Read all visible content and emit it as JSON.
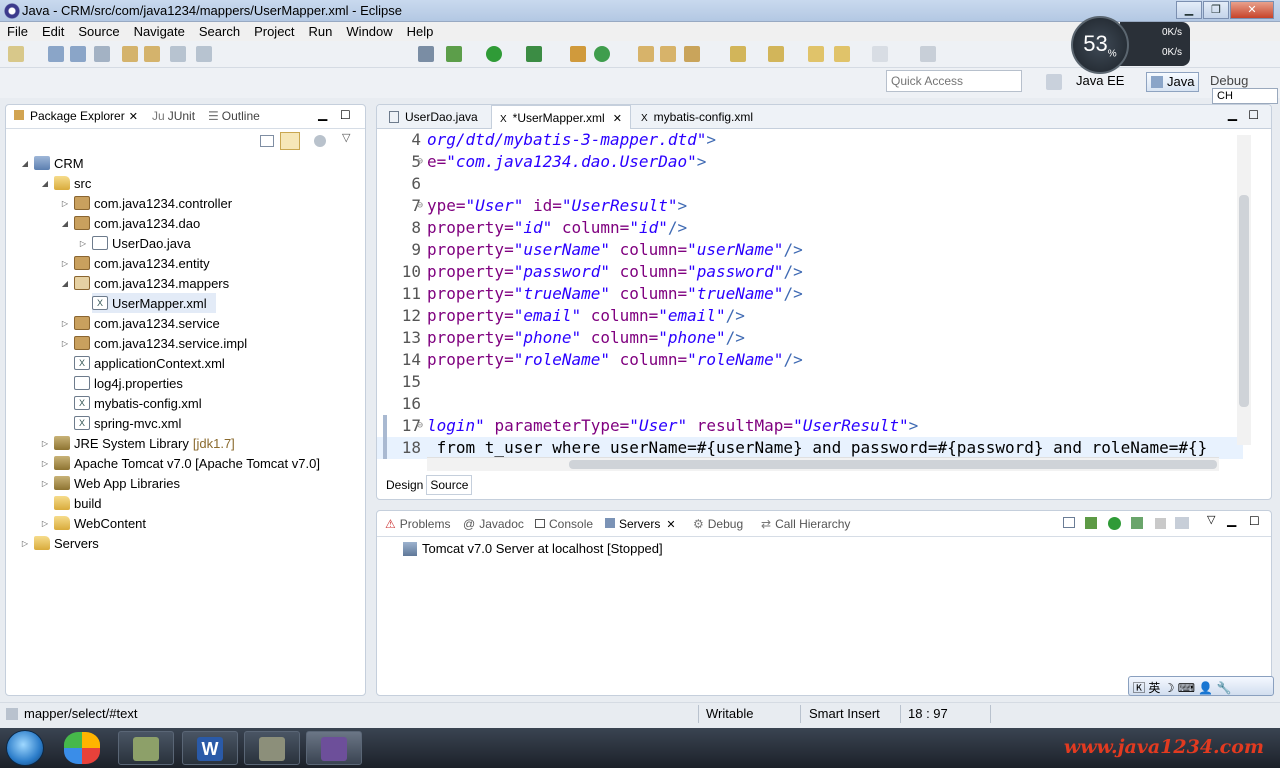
{
  "window": {
    "title": "Java - CRM/src/com/java1234/mappers/UserMapper.xml - Eclipse"
  },
  "menu": [
    "File",
    "Edit",
    "Source",
    "Navigate",
    "Search",
    "Project",
    "Run",
    "Window",
    "Help"
  ],
  "quick_access": {
    "placeholder": "Quick Access"
  },
  "perspectives": {
    "java_ee": "Java EE",
    "java": "Java",
    "debug": "Debug"
  },
  "speed_widget": {
    "percent": "53",
    "percent_sign": "%",
    "up": "0K/s",
    "down": "0K/s"
  },
  "ime": {
    "lang": "CH"
  },
  "left_panel": {
    "tabs": {
      "package_explorer": "Package Explorer",
      "junit": "JUnit",
      "outline": "Outline"
    },
    "tree": [
      {
        "label": "CRM"
      },
      {
        "label": "src"
      },
      {
        "label": "com.java1234.controller"
      },
      {
        "label": "com.java1234.dao"
      },
      {
        "label": "UserDao.java"
      },
      {
        "label": "com.java1234.entity"
      },
      {
        "label": "com.java1234.mappers"
      },
      {
        "label": "UserMapper.xml"
      },
      {
        "label": "com.java1234.service"
      },
      {
        "label": "com.java1234.service.impl"
      },
      {
        "label": "applicationContext.xml"
      },
      {
        "label": "log4j.properties"
      },
      {
        "label": "mybatis-config.xml"
      },
      {
        "label": "spring-mvc.xml"
      },
      {
        "label": "JRE System Library",
        "decoration": "[jdk1.7]"
      },
      {
        "label": "Apache Tomcat v7.0 [Apache Tomcat v7.0]"
      },
      {
        "label": "Web App Libraries"
      },
      {
        "label": "build"
      },
      {
        "label": "WebContent"
      },
      {
        "label": "Servers"
      }
    ]
  },
  "editor": {
    "tabs": [
      "UserDao.java",
      "*UserMapper.xml",
      "mybatis-config.xml"
    ],
    "lines": [
      {
        "n": "4",
        "fold": "",
        "parts": [
          [
            "str",
            "org/dtd/mybatis-3-mapper.dtd\""
          ],
          [
            "tag",
            ">"
          ]
        ]
      },
      {
        "n": "5",
        "fold": "⊖",
        "parts": [
          [
            "attr",
            "e="
          ],
          [
            "str",
            "\"com.java1234.dao.UserDao\""
          ],
          [
            "tag",
            ">"
          ]
        ]
      },
      {
        "n": "6",
        "fold": "",
        "parts": []
      },
      {
        "n": "7",
        "fold": "⊖",
        "parts": [
          [
            "attr",
            "ype="
          ],
          [
            "str",
            "\"User\""
          ],
          [
            "plain",
            " "
          ],
          [
            "attr",
            "id="
          ],
          [
            "str",
            "\"UserResult\""
          ],
          [
            "tag",
            ">"
          ]
        ]
      },
      {
        "n": "8",
        "fold": "",
        "parts": [
          [
            "attr",
            "property="
          ],
          [
            "str",
            "\"id\""
          ],
          [
            "plain",
            " "
          ],
          [
            "attr",
            "column="
          ],
          [
            "str",
            "\"id\""
          ],
          [
            "tag",
            "/>"
          ]
        ]
      },
      {
        "n": "9",
        "fold": "",
        "parts": [
          [
            "attr",
            "property="
          ],
          [
            "str",
            "\"userName\""
          ],
          [
            "plain",
            " "
          ],
          [
            "attr",
            "column="
          ],
          [
            "str",
            "\"userName\""
          ],
          [
            "tag",
            "/>"
          ]
        ]
      },
      {
        "n": "10",
        "fold": "",
        "parts": [
          [
            "attr",
            "property="
          ],
          [
            "str",
            "\"password\""
          ],
          [
            "plain",
            " "
          ],
          [
            "attr",
            "column="
          ],
          [
            "str",
            "\"password\""
          ],
          [
            "tag",
            "/>"
          ]
        ]
      },
      {
        "n": "11",
        "fold": "",
        "parts": [
          [
            "attr",
            "property="
          ],
          [
            "str",
            "\"trueName\""
          ],
          [
            "plain",
            " "
          ],
          [
            "attr",
            "column="
          ],
          [
            "str",
            "\"trueName\""
          ],
          [
            "tag",
            "/>"
          ]
        ]
      },
      {
        "n": "12",
        "fold": "",
        "parts": [
          [
            "attr",
            "property="
          ],
          [
            "str",
            "\"email\""
          ],
          [
            "plain",
            " "
          ],
          [
            "attr",
            "column="
          ],
          [
            "str",
            "\"email\""
          ],
          [
            "tag",
            "/>"
          ]
        ]
      },
      {
        "n": "13",
        "fold": "",
        "parts": [
          [
            "attr",
            "property="
          ],
          [
            "str",
            "\"phone\""
          ],
          [
            "plain",
            " "
          ],
          [
            "attr",
            "column="
          ],
          [
            "str",
            "\"phone\""
          ],
          [
            "tag",
            "/>"
          ]
        ]
      },
      {
        "n": "14",
        "fold": "",
        "parts": [
          [
            "attr",
            "property="
          ],
          [
            "str",
            "\"roleName\""
          ],
          [
            "plain",
            " "
          ],
          [
            "attr",
            "column="
          ],
          [
            "str",
            "\"roleName\""
          ],
          [
            "tag",
            "/>"
          ]
        ]
      },
      {
        "n": "15",
        "fold": "",
        "parts": []
      },
      {
        "n": "16",
        "fold": "",
        "parts": []
      },
      {
        "n": "17",
        "fold": "⊖",
        "parts": [
          [
            "str",
            "login\""
          ],
          [
            "plain",
            " "
          ],
          [
            "attr",
            "parameterType="
          ],
          [
            "str",
            "\"User\""
          ],
          [
            "plain",
            " "
          ],
          [
            "attr",
            "resultMap="
          ],
          [
            "str",
            "\"UserResult\""
          ],
          [
            "tag",
            ">"
          ]
        ]
      },
      {
        "n": "18",
        "fold": "",
        "parts": [
          [
            "plain",
            " from t_user where userName=#{userName} and password=#{password} and roleName=#{}"
          ]
        ]
      }
    ],
    "bottom_tabs": {
      "design": "Design",
      "source": "Source"
    }
  },
  "bottom_panel": {
    "tabs": [
      "Problems",
      "Javadoc",
      "Console",
      "Servers",
      "Debug",
      "Call Hierarchy"
    ],
    "server": "Tomcat v7.0 Server at localhost  [Stopped]"
  },
  "statusbar": {
    "path": "mapper/select/#text",
    "mode": "Writable",
    "insert": "Smart Insert",
    "position": "18 : 97"
  },
  "watermark": "www.java1234.com",
  "colors": {
    "tag": "#3f6ab3",
    "attr": "#7f007f",
    "string": "#2a00ff"
  }
}
